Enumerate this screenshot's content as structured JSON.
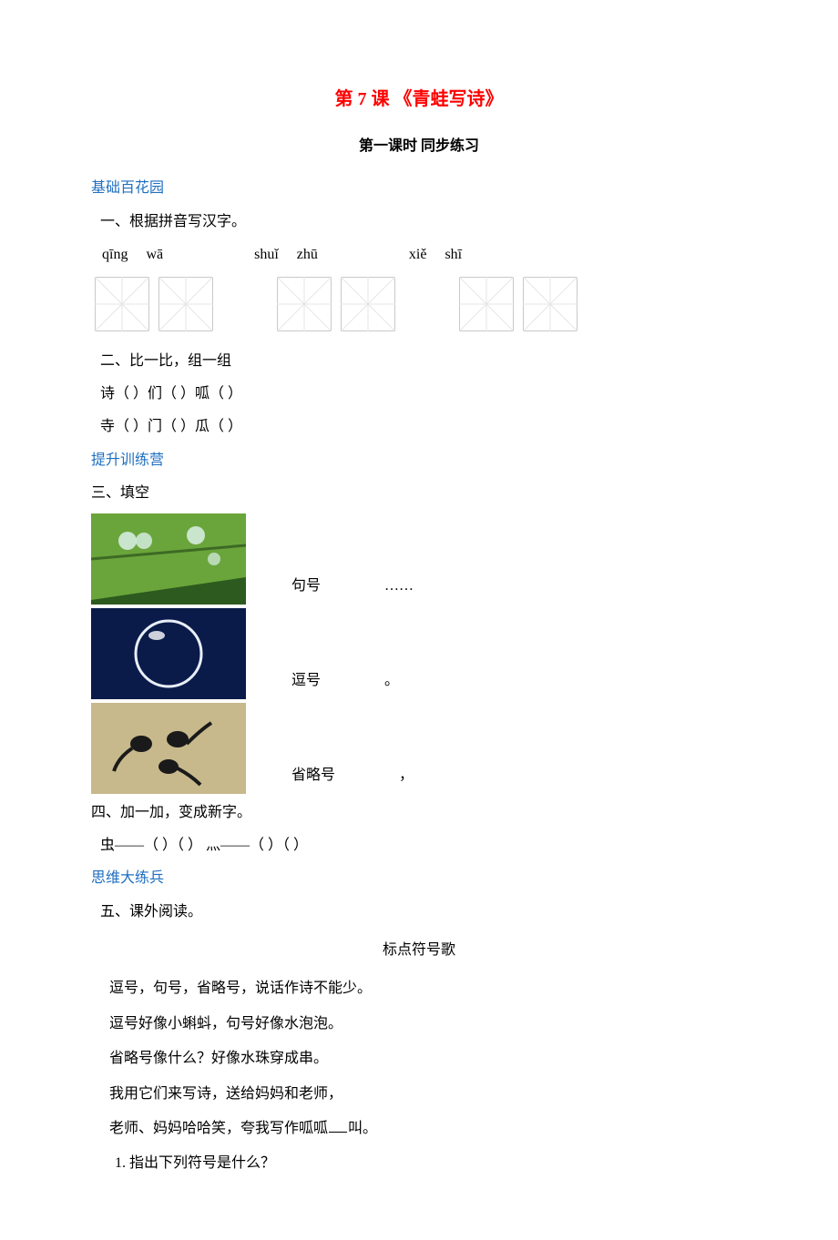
{
  "header": {
    "title": "第 7 课  《青蛙写诗》",
    "subtitle": "第一课时  同步练习"
  },
  "sections": {
    "s1_label": "基础百花园",
    "q1_title": "一、根据拼音写汉字。",
    "pinyin": {
      "p1a": "qīng",
      "p1b": "wā",
      "p2a": "shuǐ",
      "p2b": "zhū",
      "p3a": "xiě",
      "p3b": "shī"
    },
    "q2_title": "二、比一比，组一组",
    "q2_line1": "诗（     ）们（     ）呱（     ）",
    "q2_line2": "寺（     ）门（     ）瓜（     ）",
    "s2_label": "提升训练营",
    "q3_title": "三、填空",
    "q3_rows": {
      "r1_label": "句号",
      "r1_symbol": "……",
      "r2_label": "逗号",
      "r2_symbol": "。",
      "r3_label": "省略号",
      "r3_symbol": "，"
    },
    "q4_title": "四、加一加，变成新字。",
    "q4_line": "虫——（     ）（     ）    灬——（     ）（     ）",
    "s3_label": "思维大练兵",
    "q5_title": "五、课外阅读。",
    "reading_title": "标点符号歌",
    "reading_lines": {
      "l1": "逗号，句号，省略号，说话作诗不能少。",
      "l2": "逗号好像小蝌蚪，句号好像水泡泡。",
      "l3": "省略号像什么？好像水珠穿成串。",
      "l4": "我用它们来写诗，送给妈妈和老师，",
      "l5_a": "老师、妈妈哈哈笑，夸我写作呱呱",
      "l5_b": "叫。"
    },
    "q5_sub1": "1. 指出下列符号是什么？"
  }
}
